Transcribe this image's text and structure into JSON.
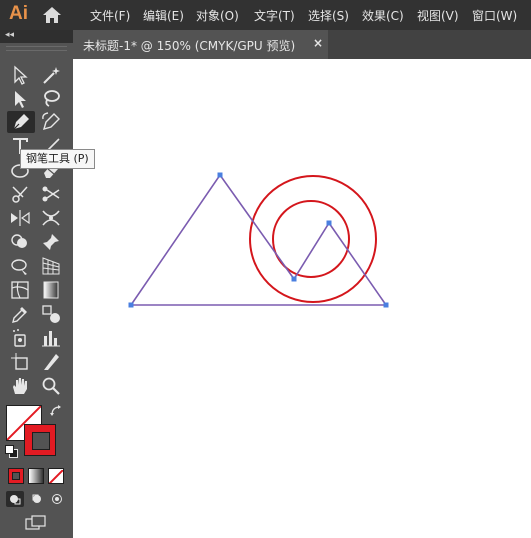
{
  "app": {
    "logo_text": "Ai",
    "logo_color": "#e8924a"
  },
  "menu": {
    "items": [
      "文件(F)",
      "编辑(E)",
      "对象(O)",
      "文字(T)",
      "选择(S)",
      "效果(C)",
      "视图(V)",
      "窗口(W)"
    ]
  },
  "toolbar": {
    "collapse_label": "◂◂",
    "tooltip": "钢笔工具 (P)",
    "active_tool": "pen-tool",
    "fill_color": "none",
    "stroke_color": "#e31b23"
  },
  "document": {
    "tab_label": "未标题-1* @ 150% (CMYK/GPU 预览)",
    "close_glyph": "×",
    "zoom": "150%",
    "color_mode": "CMYK/GPU 预览"
  },
  "artwork": {
    "path_color": "#7b5cb0",
    "anchor_color": "#4a7fe0",
    "circle_color": "#d4161c"
  }
}
